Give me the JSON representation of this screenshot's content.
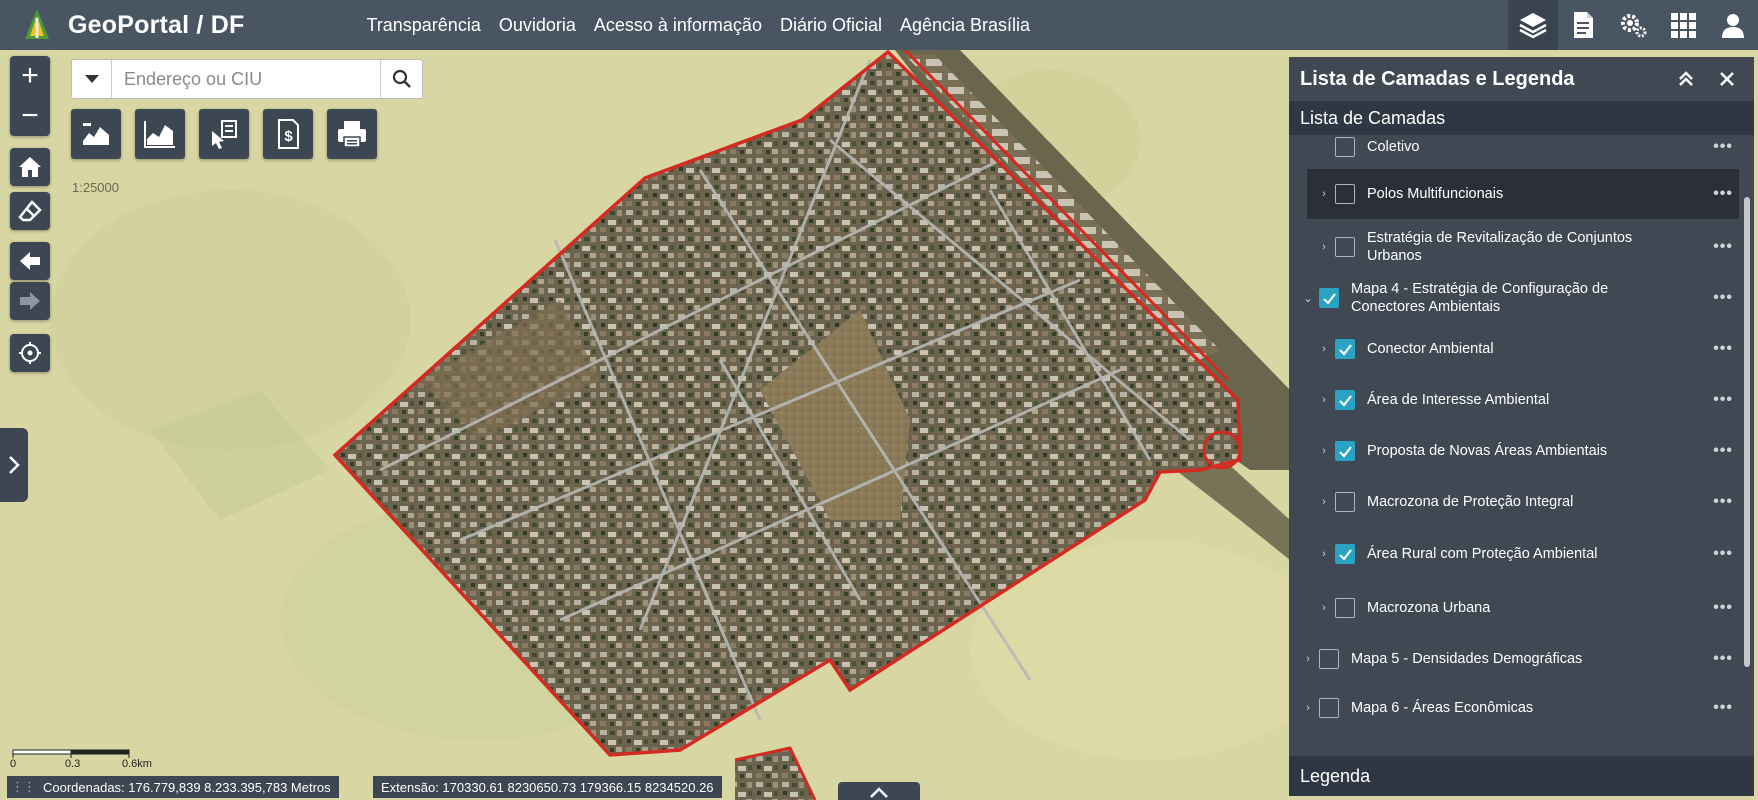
{
  "header": {
    "title": "GeoPortal / DF",
    "nav": [
      "Transparência",
      "Ouvidoria",
      "Acesso à informação",
      "Diário Oficial",
      "Agência Brasília"
    ],
    "tools": [
      "layers-icon",
      "document-icon",
      "settings-icon",
      "apps-grid-icon",
      "user-icon"
    ]
  },
  "search": {
    "placeholder": "Endereço ou CIU"
  },
  "map": {
    "scale_label": "1:25000",
    "scalebar": {
      "labels": [
        "0",
        "0.3",
        "0.6km"
      ]
    },
    "coordinates": "Coordenadas: 176.779,839 8.233.395,783 Metros",
    "extent": "Extensão: 170330.61 8230650.73 179366.15 8234520.26"
  },
  "panel": {
    "title": "Lista de Camadas e Legenda",
    "subtitle": "Lista de Camadas",
    "legend": "Legenda",
    "layers": [
      {
        "name": "Coletivo",
        "checked": false,
        "level": 1
      },
      {
        "name": "Polos Multifuncionais",
        "checked": false,
        "level": 1,
        "highlight": true
      },
      {
        "name": "Estratégia de Revitalização de Conjuntos Urbanos",
        "checked": false,
        "level": 1
      },
      {
        "name": "Mapa 4 - Estratégia de Configuração de Conectores Ambientais",
        "checked": true,
        "level": 0,
        "expanded": true
      },
      {
        "name": "Conector Ambiental",
        "checked": true,
        "level": 1
      },
      {
        "name": "Área de Interesse Ambiental",
        "checked": true,
        "level": 1
      },
      {
        "name": "Proposta de Novas Áreas Ambientais",
        "checked": true,
        "level": 1
      },
      {
        "name": "Macrozona de Proteção Integral",
        "checked": false,
        "level": 1
      },
      {
        "name": "Área Rural com Proteção Ambiental",
        "checked": true,
        "level": 1
      },
      {
        "name": "Macrozona Urbana",
        "checked": false,
        "level": 1
      },
      {
        "name": "Mapa 5 - Densidades Demográficas",
        "checked": false,
        "level": 0
      },
      {
        "name": "Mapa 6 - Áreas Econômicas",
        "checked": false,
        "level": 0
      }
    ]
  },
  "colors": {
    "topbar": "#4a5563",
    "panel": "#384250",
    "checkbox_on": "#2aa2c4",
    "boundary": "#d42a20",
    "map_background": "#d8d6a2"
  }
}
